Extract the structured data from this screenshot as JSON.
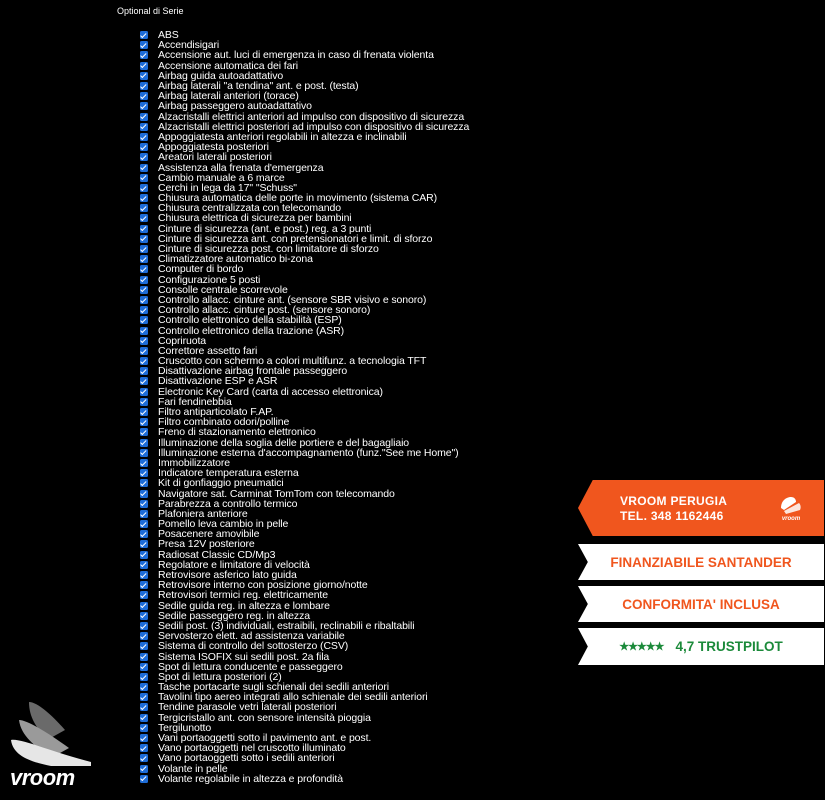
{
  "section_title": "Optional di Serie",
  "options": [
    "ABS",
    "Accendisigari",
    "Accensione aut. luci di emergenza in caso di frenata violenta",
    "Accensione automatica dei fari",
    "Airbag guida autoadattativo",
    "Airbag laterali \"a tendina\" ant. e post. (testa)",
    "Airbag laterali anteriori (torace)",
    "Airbag passeggero autoadattativo",
    "Alzacristalli elettrici anteriori ad impulso con dispositivo di sicurezza",
    "Alzacristalli elettrici posteriori ad impulso con dispositivo di sicurezza",
    "Appoggiatesta anteriori regolabili in altezza e inclinabili",
    "Appoggiatesta posteriori",
    "Areatori laterali posteriori",
    "Assistenza alla frenata d'emergenza",
    "Cambio manuale a 6 marce",
    "Cerchi in lega da 17\" \"Schuss\"",
    "Chiusura automatica delle porte in movimento (sistema CAR)",
    "Chiusura centralizzata con telecomando",
    "Chiusura elettrica di sicurezza per bambini",
    "Cinture di sicurezza (ant. e post.) reg. a 3 punti",
    "Cinture di sicurezza ant. con pretensionatori e limit. di sforzo",
    "Cinture di sicurezza post. con limitatore di sforzo",
    "Climatizzatore automatico bi-zona",
    "Computer di bordo",
    "Configurazione 5 posti",
    "Consolle centrale scorrevole",
    "Controllo allacc. cinture ant. (sensore SBR visivo e sonoro)",
    "Controllo allacc. cinture post. (sensore sonoro)",
    "Controllo elettronico della stabilità (ESP)",
    "Controllo elettronico della trazione (ASR)",
    "Copriruota",
    "Correttore assetto fari",
    "Cruscotto con schermo a colori multifunz. a tecnologia TFT",
    "Disattivazione airbag frontale passeggero",
    "Disattivazione ESP e ASR",
    "Electronic Key Card (carta di accesso elettronica)",
    "Fari fendinebbia",
    "Filtro antiparticolato F.AP.",
    "Filtro combinato odori/polline",
    "Freno di stazionamento elettronico",
    "Illuminazione della soglia delle portiere e del bagagliaio",
    "Illuminazione esterna d'accompagnamento (funz.\"See me Home\")",
    "Immobilizzatore",
    "Indicatore temperatura esterna",
    "Kit di gonfiaggio pneumatici",
    "Navigatore sat. Carminat TomTom con telecomando",
    "Parabrezza a controllo termico",
    "Plafoniera anteriore",
    "Pomello leva cambio in pelle",
    "Posacenere amovibile",
    "Presa 12V posteriore",
    "Radiosat Classic CD/Mp3",
    "Regolatore e limitatore di velocità",
    "Retrovisore asferico lato guida",
    "Retrovisore interno con posizione giorno/notte",
    "Retrovisori termici reg. elettricamente",
    "Sedile guida reg. in altezza e lombare",
    "Sedile passeggero reg. in altezza",
    "Sedili post. (3) individuali, estraibili, reclinabili e ribaltabili",
    "Servosterzo elett. ad assistenza variabile",
    "Sistema di controllo del sottosterzo (CSV)",
    "Sistema ISOFIX sui sedili post. 2a fila",
    "Spot di lettura conducente e passeggero",
    "Spot di lettura posteriori (2)",
    "Tasche portacarte sugli schienali dei sedili anteriori",
    "Tavolini tipo aereo integrati allo schienale dei sedili anteriori",
    "Tendine parasole vetri laterali posteriori",
    "Tergicristallo ant. con sensore intensità pioggia",
    "Tergilunotto",
    "Vani portaoggetti sotto il pavimento ant. e post.",
    "Vano portaoggetti nel cruscotto illuminato",
    "Vano portaoggetti sotto i sedili anteriori",
    "Volante in pelle",
    "Volante regolabile in altezza e profondità"
  ],
  "banners": {
    "dealer_name": "VROOM PERUGIA",
    "dealer_phone": "TEL. 348 1162446",
    "finance": "FINANZIABILE SANTANDER",
    "compliance": "CONFORMITA' INCLUSA",
    "rating_stars": "★★★★★",
    "rating_text": "4,7 TRUSTPILOT"
  },
  "logo_text": "vroom",
  "colors": {
    "accent": "#f0561e",
    "checkbox": "#1e6cd6",
    "trustpilot_green": "#1b8a3a"
  }
}
